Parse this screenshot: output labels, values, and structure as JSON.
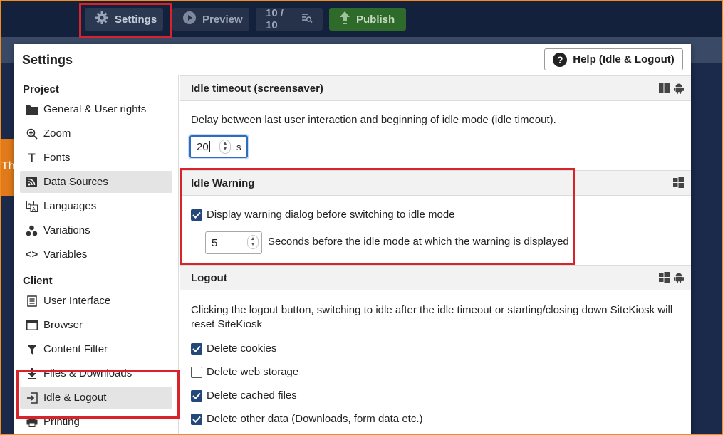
{
  "toolbar": {
    "settings_label": "Settings",
    "preview_label": "Preview",
    "pages_label": "10 / 10",
    "publish_label": "Publish"
  },
  "background": {
    "fragment_text": "Thi"
  },
  "dialog": {
    "title": "Settings",
    "help_label": "Help (Idle & Logout)"
  },
  "sidebar": {
    "project_label": "Project",
    "client_label": "Client",
    "project_items": [
      {
        "label": "General & User rights",
        "icon": "folder-icon"
      },
      {
        "label": "Zoom",
        "icon": "zoom-icon"
      },
      {
        "label": "Fonts",
        "icon": "font-icon"
      },
      {
        "label": "Data Sources",
        "icon": "rss-icon"
      },
      {
        "label": "Languages",
        "icon": "language-icon"
      },
      {
        "label": "Variations",
        "icon": "variations-icon"
      },
      {
        "label": "Variables",
        "icon": "code-icon"
      }
    ],
    "client_items": [
      {
        "label": "User Interface",
        "icon": "document-icon"
      },
      {
        "label": "Browser",
        "icon": "browser-icon"
      },
      {
        "label": "Content Filter",
        "icon": "filter-icon"
      },
      {
        "label": "Files & Downloads",
        "icon": "download-icon"
      },
      {
        "label": "Idle & Logout",
        "icon": "logout-icon"
      },
      {
        "label": "Printing",
        "icon": "printer-icon"
      }
    ],
    "active_item": "Idle & Logout"
  },
  "idle_timeout": {
    "title": "Idle timeout (screensaver)",
    "description": "Delay between last user interaction and beginning of idle mode (idle timeout).",
    "value": "20",
    "unit": "s"
  },
  "idle_warning": {
    "title": "Idle Warning",
    "checkbox_label": "Display warning dialog before switching to idle mode",
    "checked": true,
    "value": "5",
    "value_label": "Seconds before the idle mode at which the warning is displayed"
  },
  "logout": {
    "title": "Logout",
    "description": "Clicking the logout button, switching to idle after the idle timeout or starting/closing down SiteKiosk will reset SiteKiosk",
    "options": [
      {
        "label": "Delete cookies",
        "checked": true
      },
      {
        "label": "Delete web storage",
        "checked": false
      },
      {
        "label": "Delete cached files",
        "checked": true
      },
      {
        "label": "Delete other data (Downloads, form data etc.)",
        "checked": true
      }
    ]
  },
  "colors": {
    "highlight": "#d9232a",
    "checkbox": "#25487a",
    "toolbar": "#14213d",
    "publish": "#2e6b2a"
  }
}
